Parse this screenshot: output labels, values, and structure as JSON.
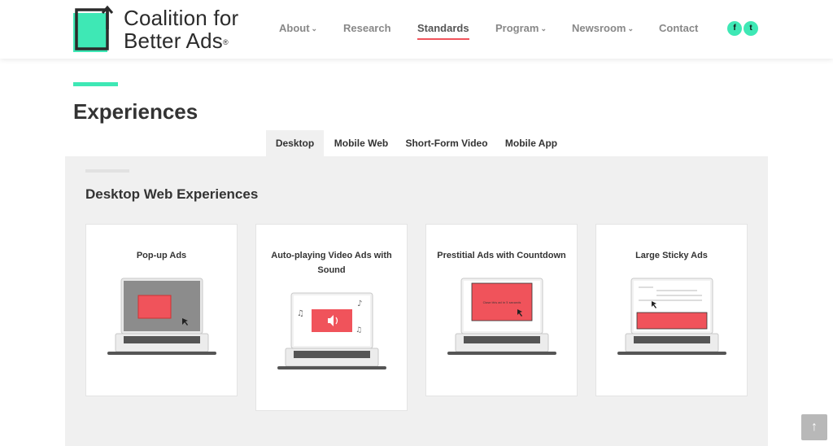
{
  "brand": {
    "name_line1": "Coalition for",
    "name_line2": "Better Ads",
    "reg_mark": "®",
    "mark_color": "#3ee8b5"
  },
  "nav": {
    "items": [
      {
        "label": "About",
        "has_dropdown": true,
        "active": false
      },
      {
        "label": "Research",
        "has_dropdown": false,
        "active": false
      },
      {
        "label": "Standards",
        "has_dropdown": false,
        "active": true
      },
      {
        "label": "Program",
        "has_dropdown": true,
        "active": false
      },
      {
        "label": "Newsroom",
        "has_dropdown": true,
        "active": false
      },
      {
        "label": "Contact",
        "has_dropdown": false,
        "active": false
      }
    ],
    "dropdown_glyph": "⌄",
    "social": [
      {
        "icon": "facebook-icon",
        "glyph": "f"
      },
      {
        "icon": "twitter-icon",
        "glyph": "t"
      }
    ]
  },
  "page": {
    "title": "Experiences"
  },
  "tabs": [
    {
      "label": "Desktop",
      "active": true
    },
    {
      "label": "Mobile Web",
      "active": false
    },
    {
      "label": "Short-Form Video",
      "active": false
    },
    {
      "label": "Mobile App",
      "active": false
    }
  ],
  "section": {
    "title": "Desktop Web Experiences"
  },
  "cards": [
    {
      "title": "Pop-up Ads",
      "illustration": "laptop-popup"
    },
    {
      "title": "Auto-playing Video Ads with Sound",
      "illustration": "laptop-autoplay-video"
    },
    {
      "title": "Prestitial Ads with Countdown",
      "illustration": "laptop-prestitial",
      "countdown_text": "Close this ad in 5 seconds"
    },
    {
      "title": "Large Sticky Ads",
      "illustration": "laptop-sticky"
    }
  ],
  "scroll_top": {
    "glyph": "↑",
    "icon": "arrow-up-icon"
  },
  "colors": {
    "accent": "#3ee8b5",
    "ad_red": "#f0535b",
    "active_underline": "#f0535b",
    "panel_bg": "#f0f0f0"
  }
}
